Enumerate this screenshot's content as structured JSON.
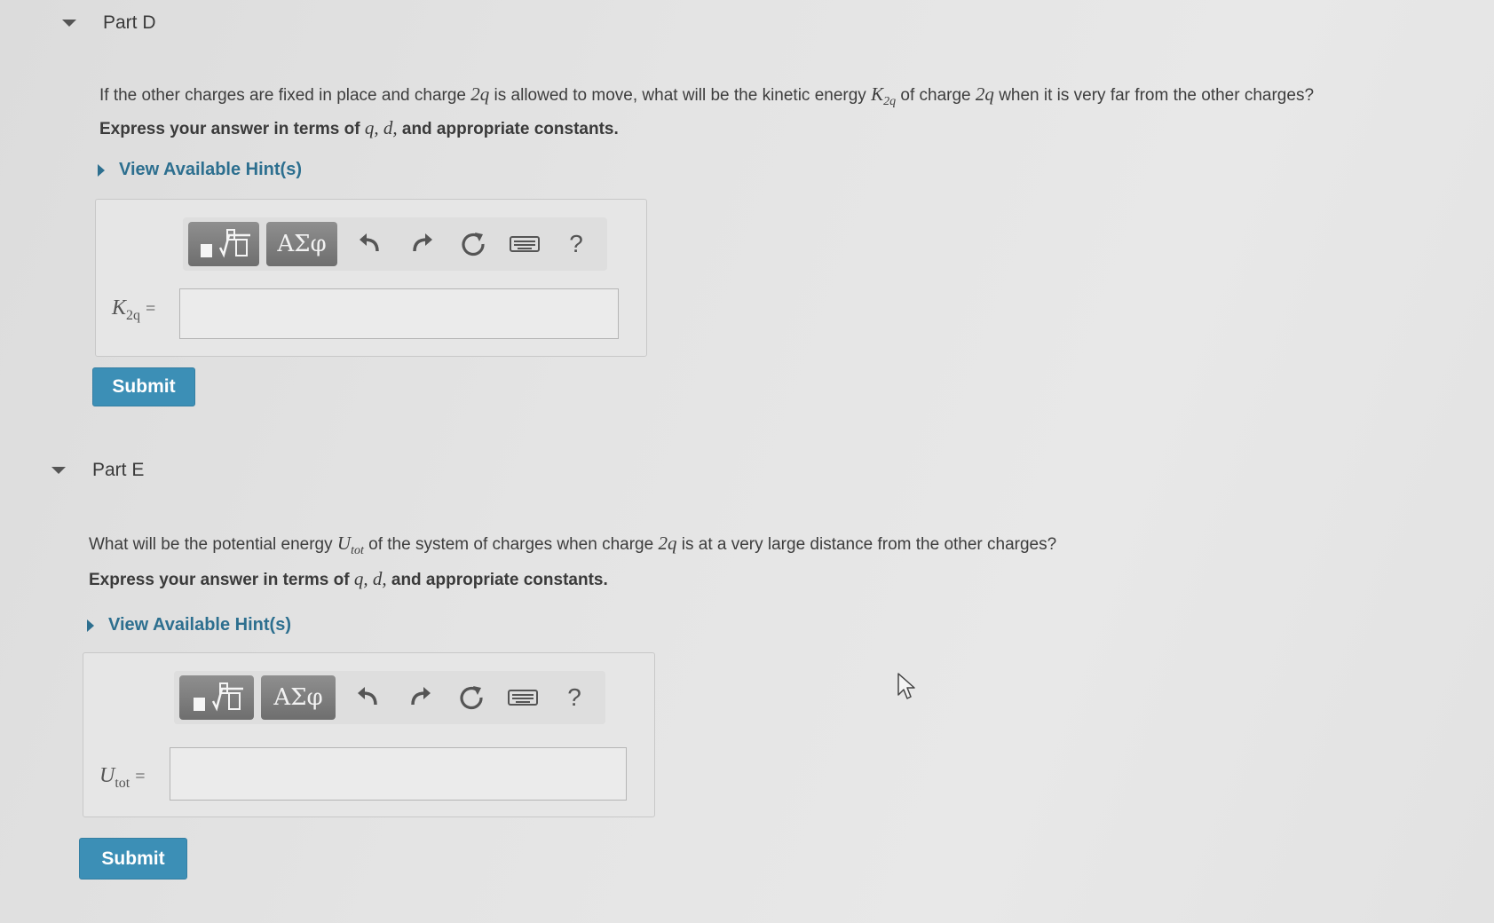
{
  "partD": {
    "title": "Part D",
    "question_pre": "If the other charges are fixed in place and charge",
    "charge": "2q",
    "question_mid": "is allowed to move, what will be the kinetic energy",
    "ke_var": "K",
    "ke_sub": "2q",
    "question_mid2": "of charge",
    "question_post": "when it is very far from the other charges?",
    "instr_pre": "Express your answer in terms of",
    "instr_vars": "q, d,",
    "instr_post": "and appropriate constants.",
    "hint_label": "View Available Hint(s)",
    "answer_var": "K",
    "answer_sub": "2q",
    "equals": "=",
    "submit_label": "Submit"
  },
  "partE": {
    "title": "Part E",
    "question_pre": "What will be the potential energy",
    "pe_var": "U",
    "pe_sub": "tot",
    "question_mid": "of the system of charges when charge",
    "charge": "2q",
    "question_post": "is at a very large distance from the other charges?",
    "instr_pre": "Express your answer in terms of",
    "instr_vars": "q, d,",
    "instr_post": "and appropriate constants.",
    "hint_label": "View Available Hint(s)",
    "answer_var": "U",
    "answer_sub": "tot",
    "equals": "=",
    "submit_label": "Submit"
  },
  "toolbar": {
    "templates_icon": "templates-icon",
    "greek_label": "ΑΣφ",
    "undo_icon": "undo-icon",
    "redo_icon": "redo-icon",
    "reset_icon": "reset-icon",
    "keyboard_icon": "keyboard-icon",
    "help_label": "?"
  }
}
